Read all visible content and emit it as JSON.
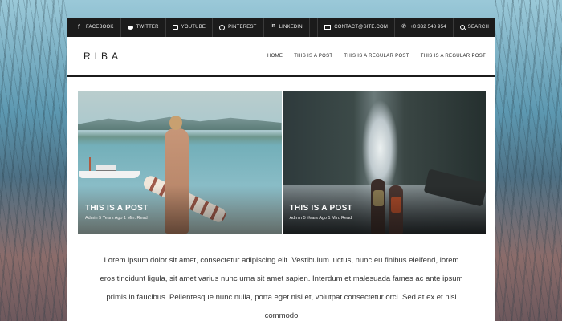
{
  "topbar": {
    "social": [
      {
        "icon": "facebook-icon",
        "label": "FACEBOOK"
      },
      {
        "icon": "twitter-icon",
        "label": "TWITTER"
      },
      {
        "icon": "youtube-icon",
        "label": "YOUTUBE"
      },
      {
        "icon": "pinterest-icon",
        "label": "PINTEREST"
      },
      {
        "icon": "linkedin-icon",
        "label": "LINKEDIN"
      }
    ],
    "email": "CONTACT@SITE.COM",
    "phone": "+0 332 548 954",
    "search_label": "SEARCH"
  },
  "header": {
    "logo": "RIBA",
    "nav": [
      "HOME",
      "THIS IS A POST",
      "THIS IS A REGULAR POST",
      "THIS IS A REGULAR POST"
    ]
  },
  "featured": [
    {
      "title": "THIS IS A POST",
      "meta": "Admin   5 Years Ago   1 Min. Read"
    },
    {
      "title": "THIS IS A POST",
      "meta": "Admin   5 Years Ago   1 Min. Read"
    }
  ],
  "content": {
    "paragraph": "Lorem ipsum dolor sit amet, consectetur adipiscing elit. Vestibulum luctus, nunc eu finibus eleifend, lorem eros tincidunt ligula, sit amet varius nunc urna sit amet sapien. Interdum et malesuada fames ac ante ipsum primis in faucibus. Pellentesque nunc nulla, porta eget nisl et, volutpat consectetur orci. Sed at ex et nisi commodo"
  }
}
